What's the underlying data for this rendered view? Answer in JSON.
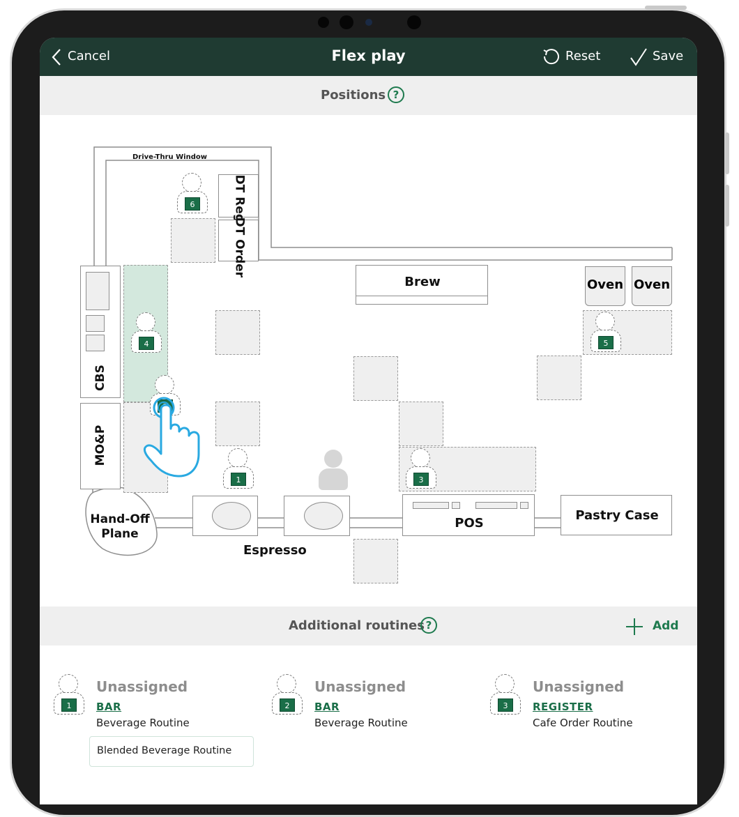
{
  "header": {
    "cancel_label": "Cancel",
    "title": "Flex play",
    "reset_label": "Reset",
    "save_label": "Save"
  },
  "positions": {
    "title": "Positions",
    "help_glyph": "?"
  },
  "floor_plan": {
    "labels": {
      "drive_thru_window": "Drive-Thru Window",
      "dt_reg": "DT Reg",
      "dt_order": "DT Order",
      "brew": "Brew",
      "oven_1": "Oven",
      "oven_2": "Oven",
      "cbs": "CBS",
      "mop": "MO&P",
      "hand_off_plane": "Hand-Off Plane",
      "espresso": "Espresso",
      "pos": "POS",
      "pastry_case": "Pastry Case"
    },
    "badges": [
      "6",
      "4",
      "2",
      "1",
      "3",
      "5"
    ],
    "highlight_color": "#d3e8dd",
    "badge_color": "#1a6e48"
  },
  "additional_routines": {
    "title": "Additional routines",
    "help_glyph": "?",
    "add_label": "Add",
    "items": [
      {
        "number": "1",
        "status": "Unassigned",
        "role": "BAR",
        "routine": "Beverage Routine",
        "extra": "Blended Beverage Routine"
      },
      {
        "number": "2",
        "status": "Unassigned",
        "role": "BAR",
        "routine": "Beverage Routine"
      },
      {
        "number": "3",
        "status": "Unassigned",
        "role": "REGISTER",
        "routine": "Cafe Order Routine"
      }
    ]
  },
  "colors": {
    "header_bg": "#1f3b32",
    "accent_green": "#1e7a4e",
    "pointer_blue": "#29a9e1"
  }
}
